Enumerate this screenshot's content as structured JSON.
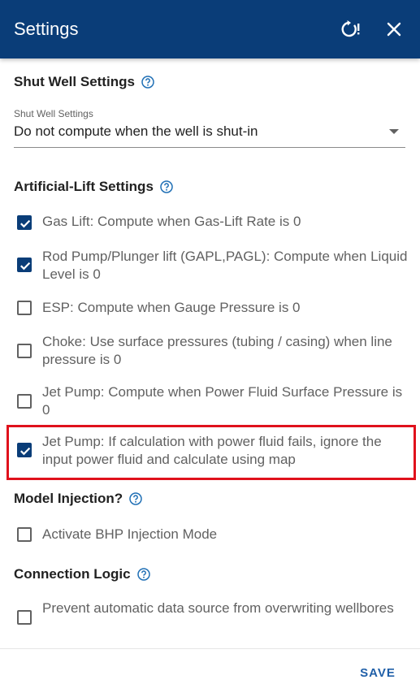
{
  "header": {
    "title": "Settings"
  },
  "shut_well": {
    "title": "Shut Well Settings",
    "select_label": "Shut Well Settings",
    "select_value": "Do not compute when the well is shut-in"
  },
  "artificial_lift": {
    "title": "Artificial-Lift Settings",
    "items": [
      {
        "label": "Gas Lift: Compute when Gas-Lift Rate is 0",
        "checked": true
      },
      {
        "label": "Rod Pump/Plunger lift (GAPL,PAGL): Compute when Liquid Level is 0",
        "checked": true
      },
      {
        "label": "ESP: Compute when Gauge Pressure is 0",
        "checked": false
      },
      {
        "label": "Choke: Use surface pressures (tubing / casing) when line pressure is 0",
        "checked": false
      },
      {
        "label": "Jet Pump: Compute when Power Fluid Surface Pressure is 0",
        "checked": false
      },
      {
        "label": "Jet Pump: If calculation with power fluid fails, ignore the input power fluid and calculate using map",
        "checked": true
      }
    ]
  },
  "model_injection": {
    "title": "Model Injection?",
    "items": [
      {
        "label": "Activate BHP Injection Mode",
        "checked": false
      }
    ]
  },
  "connection_logic": {
    "title": "Connection Logic",
    "items": [
      {
        "label": "Prevent automatic data source from overwriting wellbores",
        "checked": false
      }
    ]
  },
  "footer": {
    "save_label": "SAVE"
  },
  "colors": {
    "header_bg": "#0a3d78",
    "checkbox_checked": "#0a3d78",
    "help_icon": "#1f6fb5",
    "save": "#1f5fa8",
    "highlight": "#e0111c"
  }
}
